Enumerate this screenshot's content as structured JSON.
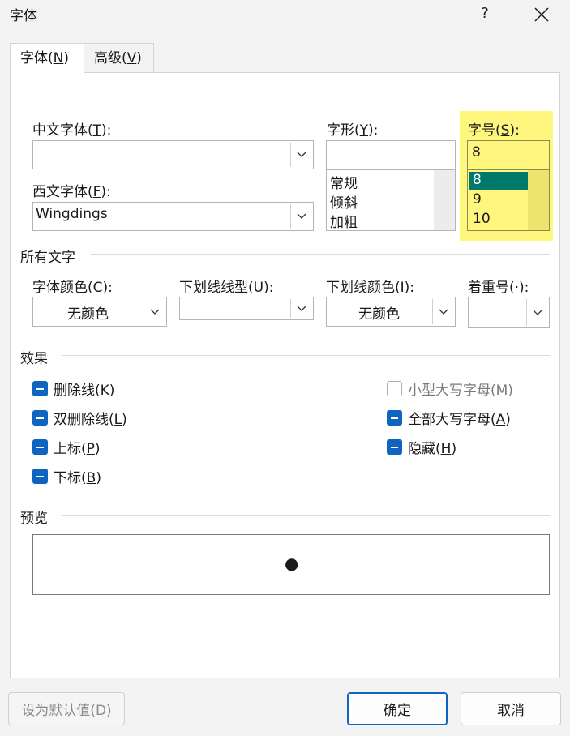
{
  "window": {
    "title": "字体",
    "help": "?"
  },
  "tabs": [
    {
      "label": "字体(",
      "key": "N",
      "suffix": ")"
    },
    {
      "label": "高级(",
      "key": "V",
      "suffix": ")"
    }
  ],
  "font": {
    "chinese_label": "中文字体(",
    "chinese_key": "T",
    "chinese_suffix": "):",
    "chinese_value": "",
    "western_label": "西文字体(",
    "western_key": "F",
    "western_suffix": "):",
    "western_value": "Wingdings",
    "style_label": "字形(",
    "style_key": "Y",
    "style_suffix": "):",
    "style_value": "",
    "style_options": [
      "常规",
      "倾斜",
      "加粗"
    ],
    "size_label": "字号(",
    "size_key": "S",
    "size_suffix": "):",
    "size_value": "8",
    "size_options": [
      "8",
      "9",
      "10"
    ],
    "size_selected_index": 0
  },
  "all_text": {
    "section": "所有文字",
    "color_label": "字体颜色(",
    "color_key": "C",
    "color_suffix": "):",
    "color_value": "无颜色",
    "underline_label": "下划线线型(",
    "underline_key": "U",
    "underline_suffix": "):",
    "underline_value": "",
    "underline_color_label": "下划线颜色(",
    "underline_color_key": "I",
    "underline_color_suffix": "):",
    "underline_color_value": "无颜色",
    "emphasis_label": "着重号(",
    "emphasis_key": "·",
    "emphasis_suffix": "):",
    "emphasis_value": ""
  },
  "effects": {
    "section": "效果",
    "strikethrough": {
      "label": "删除线(",
      "key": "K",
      "suffix": ")"
    },
    "double_strikethrough": {
      "label": "双删除线(",
      "key": "L",
      "suffix": ")"
    },
    "superscript": {
      "label": "上标(",
      "key": "P",
      "suffix": ")"
    },
    "subscript": {
      "label": "下标(",
      "key": "B",
      "suffix": ")"
    },
    "small_caps": {
      "label": "小型大写字母(M)"
    },
    "all_caps": {
      "label": "全部大写字母(",
      "key": "A",
      "suffix": ")"
    },
    "hidden": {
      "label": "隐藏(",
      "key": "H",
      "suffix": ")"
    }
  },
  "preview": {
    "section": "预览",
    "sample": "●"
  },
  "buttons": {
    "set_default": "设为默认值(D)",
    "ok": "确定",
    "cancel": "取消"
  },
  "colors": {
    "accent": "#0f64c0",
    "highlight": "#fff67e",
    "selected": "#00786a"
  }
}
